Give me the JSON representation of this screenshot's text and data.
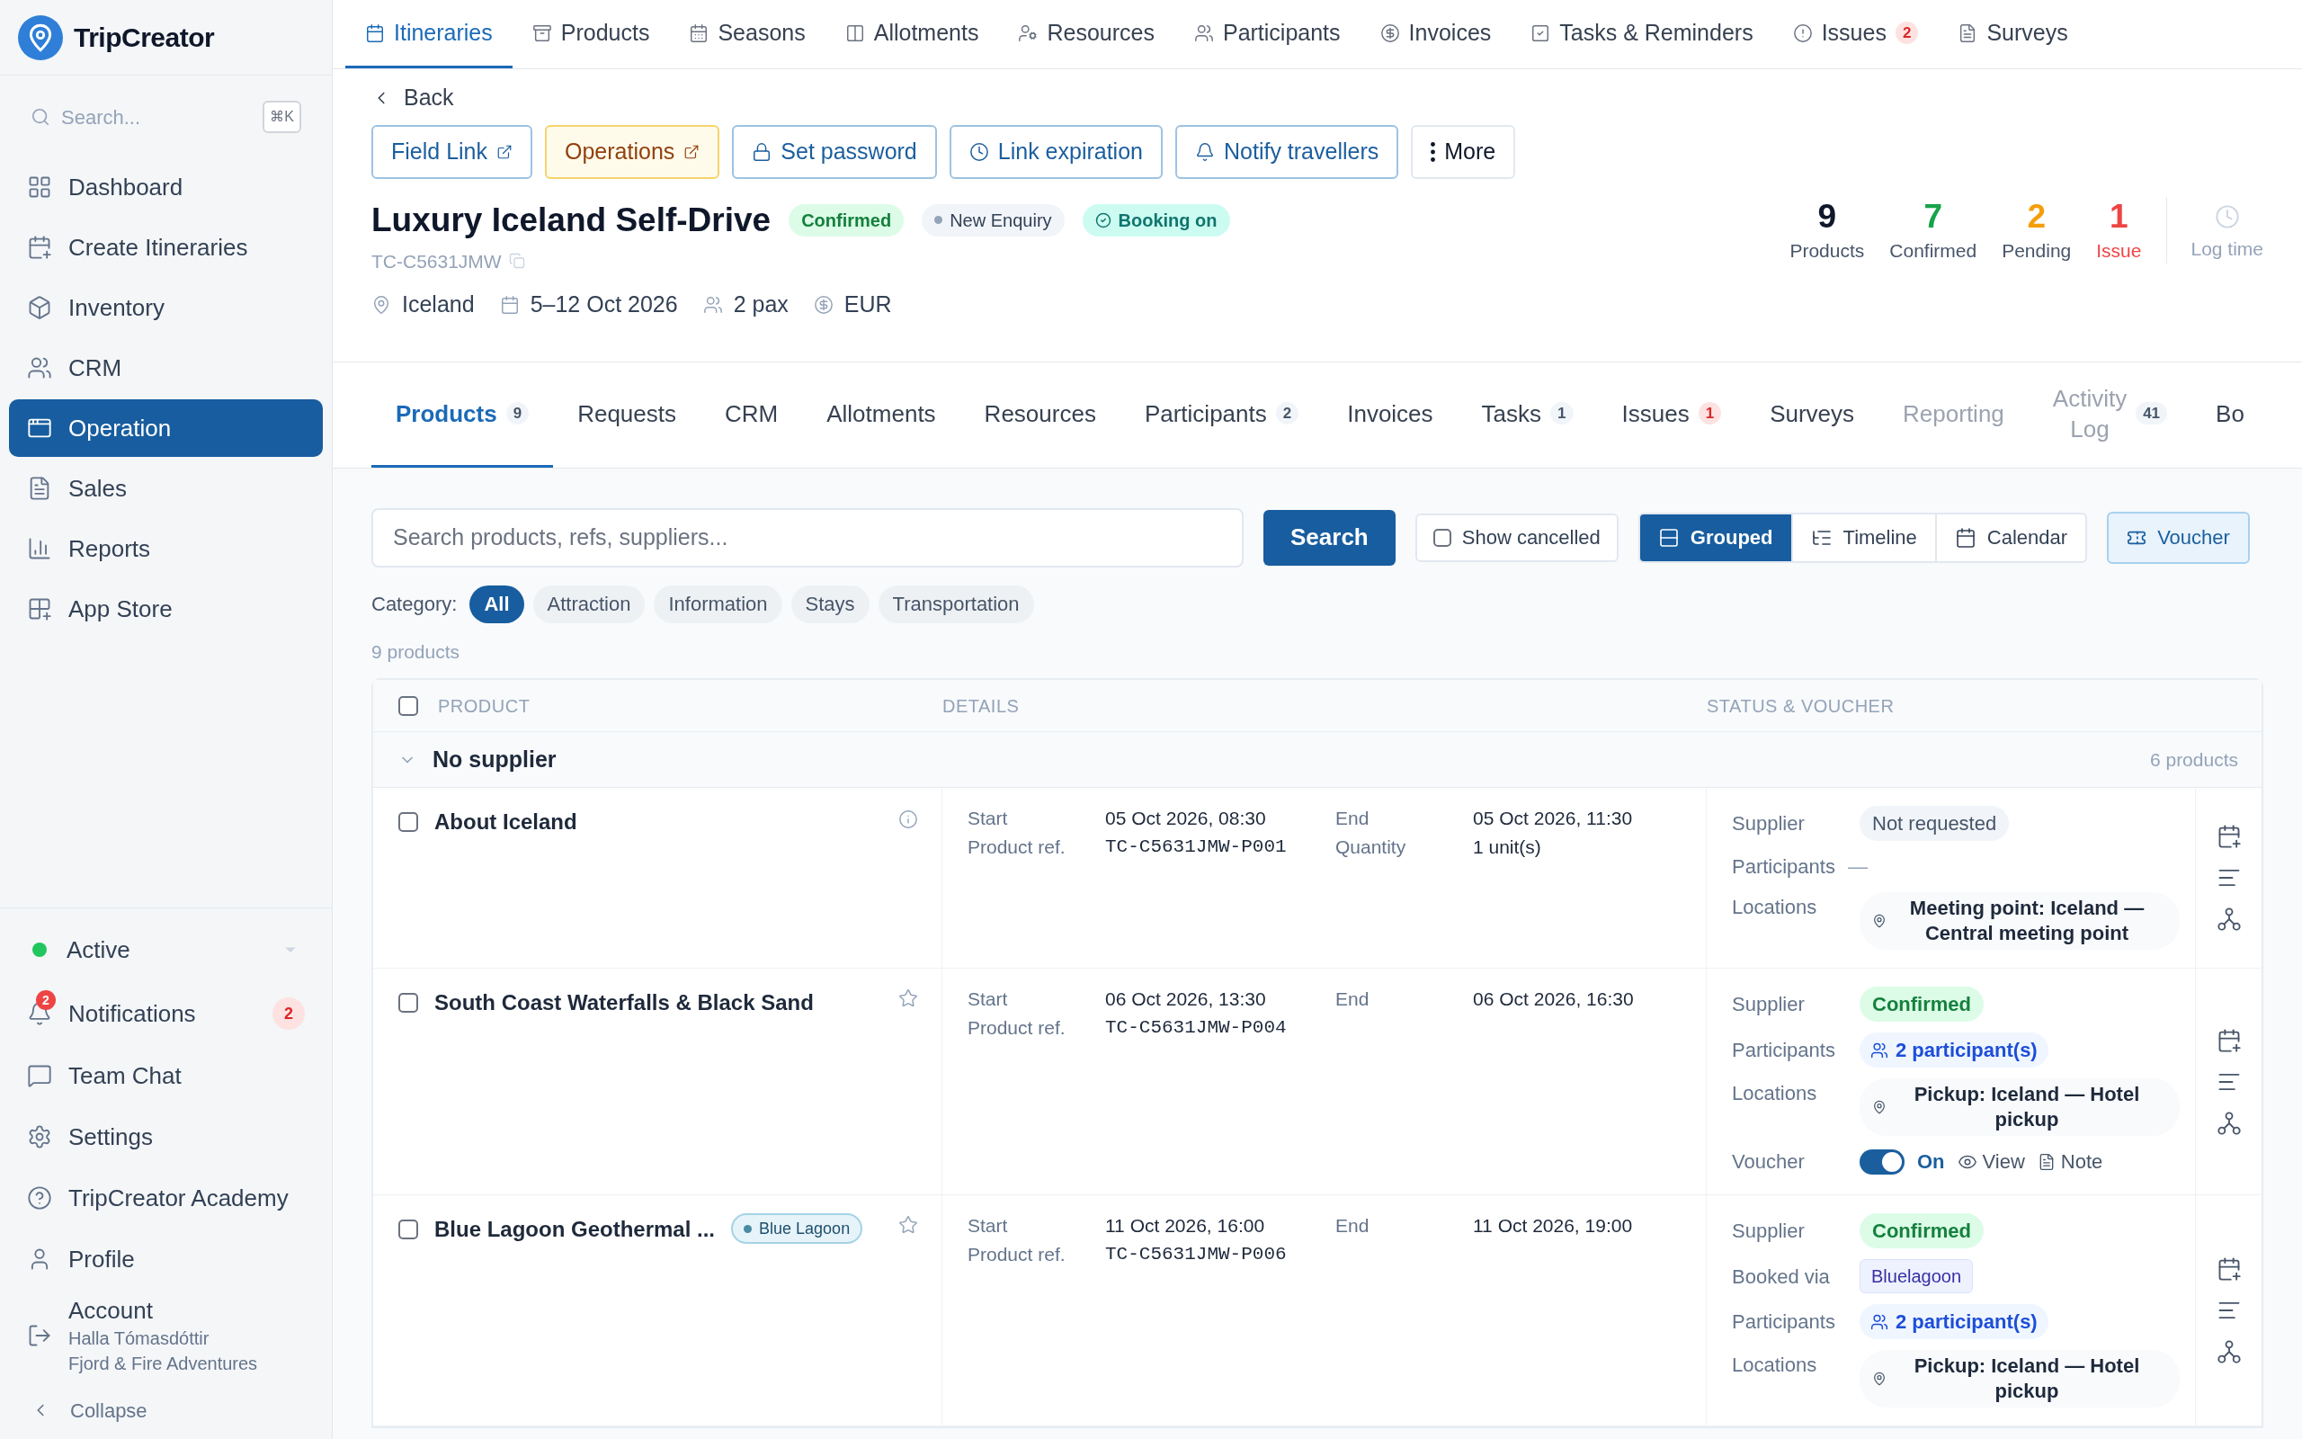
{
  "sidebar": {
    "logo": "TripCreator",
    "search": {
      "placeholder": "Search...",
      "shortcut": "⌘K"
    },
    "items": [
      {
        "label": "Dashboard",
        "selected": false
      },
      {
        "label": "Create Itineraries",
        "selected": false
      },
      {
        "label": "Inventory",
        "selected": false
      },
      {
        "label": "CRM",
        "selected": false
      },
      {
        "label": "Operation",
        "selected": true
      },
      {
        "label": "Sales",
        "selected": false
      },
      {
        "label": "Reports",
        "selected": false
      },
      {
        "label": "App Store",
        "selected": false
      }
    ],
    "status": {
      "label": "Active",
      "color": "#22c55e"
    },
    "notifications": {
      "label": "Notifications",
      "badge": "2",
      "count": "2"
    },
    "links": [
      {
        "label": "Team Chat"
      },
      {
        "label": "Settings"
      },
      {
        "label": "TripCreator Academy"
      },
      {
        "label": "Profile"
      }
    ],
    "account": {
      "label": "Account",
      "name": "Halla Tómasdóttir",
      "company": "Fjord & Fire Adventures"
    },
    "collapse": "Collapse"
  },
  "top_nav": [
    {
      "label": "Itineraries",
      "selected": true
    },
    {
      "label": "Products",
      "selected": false
    },
    {
      "label": "Seasons",
      "selected": false
    },
    {
      "label": "Allotments",
      "selected": false
    },
    {
      "label": "Resources",
      "selected": false
    },
    {
      "label": "Participants",
      "selected": false
    },
    {
      "label": "Invoices",
      "selected": false
    },
    {
      "label": "Tasks & Reminders",
      "selected": false
    },
    {
      "label": "Issues",
      "selected": false,
      "badge": "2"
    },
    {
      "label": "Surveys",
      "selected": false
    }
  ],
  "header": {
    "back": "Back",
    "actions": [
      {
        "label": "Field Link",
        "kind": "external"
      },
      {
        "label": "Operations",
        "kind": "warning"
      },
      {
        "label": "Set password",
        "kind": "link"
      },
      {
        "label": "Link expiration",
        "kind": "link"
      },
      {
        "label": "Notify travellers",
        "kind": "link"
      },
      {
        "label": "More",
        "kind": "menu"
      }
    ],
    "title": "Luxury Iceland Self-Drive",
    "badges": [
      {
        "label": "Confirmed",
        "kind": "success"
      },
      {
        "label": "New Enquiry",
        "kind": "neutral"
      },
      {
        "label": "Booking on",
        "kind": "booking"
      }
    ],
    "ref": "TC-C5631JMW",
    "meta": [
      "Iceland",
      "5–12 Oct 2026",
      "2 pax",
      "EUR"
    ],
    "stats": [
      {
        "value": "9",
        "label": "Products",
        "kind": "neutral"
      },
      {
        "value": "7",
        "label": "Confirmed",
        "kind": "success"
      },
      {
        "value": "2",
        "label": "Pending",
        "kind": "warning"
      },
      {
        "value": "1",
        "label": "Issue",
        "kind": "danger"
      }
    ],
    "log_time": "Log time"
  },
  "tabs": [
    {
      "label": "Products",
      "count": "9",
      "kind": "default",
      "selected": true,
      "muted": false
    },
    {
      "label": "Requests",
      "selected": false,
      "muted": false
    },
    {
      "label": "CRM",
      "selected": false,
      "muted": false
    },
    {
      "label": "Allotments",
      "selected": false,
      "muted": false
    },
    {
      "label": "Resources",
      "selected": false,
      "muted": false
    },
    {
      "label": "Participants",
      "count": "2",
      "kind": "default",
      "selected": false,
      "muted": false
    },
    {
      "label": "Invoices",
      "selected": false,
      "muted": false
    },
    {
      "label": "Tasks",
      "count": "1",
      "kind": "default",
      "selected": false,
      "muted": false
    },
    {
      "label": "Issues",
      "count": "1",
      "kind": "alert",
      "selected": false,
      "muted": false
    },
    {
      "label": "Surveys",
      "selected": false,
      "muted": false
    },
    {
      "label": "Reporting",
      "selected": false,
      "muted": true
    },
    {
      "label": "Activity Log",
      "count": "41",
      "kind": "default",
      "selected": false,
      "muted": true
    },
    {
      "label": "Bo",
      "selected": false,
      "muted": false
    }
  ],
  "toolbar": {
    "search": {
      "placeholder": "Search products, refs, suppliers..."
    },
    "search_button": "Search",
    "show_cancelled": {
      "label": "Show cancelled",
      "checked": false
    },
    "views": [
      {
        "label": "Grouped",
        "selected": true
      },
      {
        "label": "Timeline",
        "selected": false
      },
      {
        "label": "Calendar",
        "selected": false
      }
    ],
    "voucher": "Voucher"
  },
  "categories": {
    "label": "Category:",
    "items": [
      {
        "label": "All",
        "selected": true
      },
      {
        "label": "Attraction",
        "selected": false
      },
      {
        "label": "Information",
        "selected": false
      },
      {
        "label": "Stays",
        "selected": false
      },
      {
        "label": "Transportation",
        "selected": false
      }
    ]
  },
  "product_count": "9 products",
  "table": {
    "select_all": false,
    "columns": [
      "PRODUCT",
      "DETAILS",
      "STATUS & VOUCHER"
    ],
    "group": {
      "name": "No supplier",
      "expanded": true,
      "count": "6 products"
    },
    "rows": [
      {
        "name": "About Iceland",
        "checked": false,
        "kind": "info",
        "start": {
          "label": "Start",
          "value": "05 Oct 2026, 08:30"
        },
        "ref": {
          "label": "Product ref.",
          "value": "TC-C5631JMW-P001"
        },
        "end": {
          "label": "End",
          "value": "05 Oct 2026, 11:30"
        },
        "quantity": {
          "label": "Quantity",
          "value": "1 unit(s)"
        },
        "status": [
          {
            "label": "Supplier",
            "kind": "neutral",
            "value": "Not requested"
          },
          {
            "label": "Participants",
            "kind": "plain",
            "value": "—"
          },
          {
            "label": "Locations",
            "kind": "location",
            "value": "Meeting point: Iceland — Central meeting point"
          }
        ]
      },
      {
        "name": "South Coast Waterfalls & Black Sand",
        "checked": false,
        "kind": "starred",
        "start": {
          "label": "Start",
          "value": "06 Oct 2026, 13:30"
        },
        "ref": {
          "label": "Product ref.",
          "value": "TC-C5631JMW-P004"
        },
        "end": {
          "label": "End",
          "value": "06 Oct 2026, 16:30"
        },
        "status": [
          {
            "label": "Supplier",
            "kind": "success",
            "value": "Confirmed"
          },
          {
            "label": "Participants",
            "kind": "participants",
            "value": "2 participant(s)"
          },
          {
            "label": "Locations",
            "kind": "location",
            "value": "Pickup: Iceland — Hotel pickup"
          },
          {
            "label": "Voucher",
            "kind": "voucher",
            "on": true,
            "value": "On",
            "view": "View",
            "note": "Note"
          }
        ]
      },
      {
        "name": "Blue Lagoon Geothermal ...",
        "tag": "Blue Lagoon",
        "checked": false,
        "kind": "starred",
        "start": {
          "label": "Start",
          "value": "11 Oct 2026, 16:00"
        },
        "ref": {
          "label": "Product ref.",
          "value": "TC-C5631JMW-P006"
        },
        "end": {
          "label": "End",
          "value": "11 Oct 2026, 19:00"
        },
        "status": [
          {
            "label": "Supplier",
            "kind": "success",
            "value": "Confirmed"
          },
          {
            "label": "Booked via",
            "kind": "via",
            "value": "Bluelagoon"
          },
          {
            "label": "Participants",
            "kind": "participants",
            "value": "2 participant(s)"
          },
          {
            "label": "Locations",
            "kind": "location",
            "value": "Pickup: Iceland — Hotel pickup"
          }
        ]
      }
    ]
  }
}
